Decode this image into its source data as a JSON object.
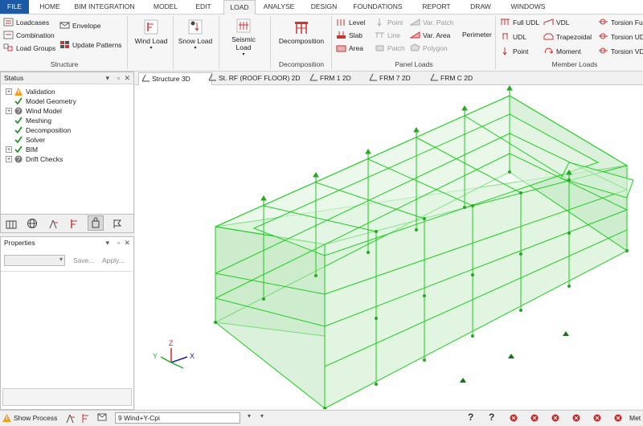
{
  "menu": {
    "items": [
      "FILE",
      "HOME",
      "BIM INTEGRATION",
      "MODEL",
      "EDIT",
      "LOAD",
      "ANALYSE",
      "DESIGN",
      "FOUNDATIONS",
      "REPORT",
      "DRAW",
      "WINDOWS"
    ],
    "active": "LOAD"
  },
  "ribbon": {
    "structure": {
      "group_label": "Structure",
      "loadcases": "Loadcases",
      "combination": "Combination",
      "load_groups": "Load Groups",
      "envelope": "Envelope",
      "update_patterns": "Update Patterns"
    },
    "wind_load": "Wind Load",
    "snow_load": "Snow Load",
    "seismic_load": "Seismic Load",
    "decomposition": {
      "button": "Decomposition",
      "group_label": "Decomposition"
    },
    "panel_loads": {
      "group_label": "Panel Loads",
      "level": "Level",
      "slab": "Slab",
      "area": "Area",
      "point": "Point",
      "line": "Line",
      "patch": "Patch",
      "var_patch": "Var. Patch",
      "var_area": "Var. Area",
      "polygon": "Polygon",
      "perimeter": "Perimeter"
    },
    "member_loads": {
      "group_label": "Member Loads",
      "full_udl": "Full UDL",
      "udl": "UDL",
      "point": "Point",
      "vdl": "VDL",
      "trapezoidal": "Trapezoidal",
      "moment": "Moment",
      "torsion_full": "Torsion Ful",
      "torsion_udl": "Torsion UD",
      "torsion_vdl": "Torsion VD"
    }
  },
  "status_panel": {
    "title": "Status",
    "items": [
      {
        "label": "Validation",
        "icon": "warning-icon",
        "expandable": true
      },
      {
        "label": "Model Geometry",
        "icon": "check-icon",
        "expandable": false
      },
      {
        "label": "Wind Model",
        "icon": "question-icon",
        "expandable": true
      },
      {
        "label": "Meshing",
        "icon": "check-icon",
        "expandable": false
      },
      {
        "label": "Decomposition",
        "icon": "check-icon",
        "expandable": false
      },
      {
        "label": "Solver",
        "icon": "check-icon",
        "expandable": false
      },
      {
        "label": "BIM",
        "icon": "check-icon",
        "expandable": true
      },
      {
        "label": "Drift Checks",
        "icon": "question-icon",
        "expandable": true
      }
    ]
  },
  "properties_panel": {
    "title": "Properties",
    "save": "Save...",
    "apply": "Apply..."
  },
  "view_tabs": [
    "Structure 3D",
    "St. RF (ROOF FLOOR) 2D",
    "FRM 1 2D",
    "FRM 7 2D",
    "FRM C 2D"
  ],
  "axes": {
    "x": "X",
    "y": "Y",
    "z": "Z"
  },
  "statusbar": {
    "show_process": "Show Process",
    "loadcase_value": "9 Wind+Y-Cpi",
    "trailing": "Met"
  },
  "colors": {
    "accent": "#1c5aa6",
    "model_green": "#22cc22",
    "panel_fill": "#c8ecc8"
  }
}
